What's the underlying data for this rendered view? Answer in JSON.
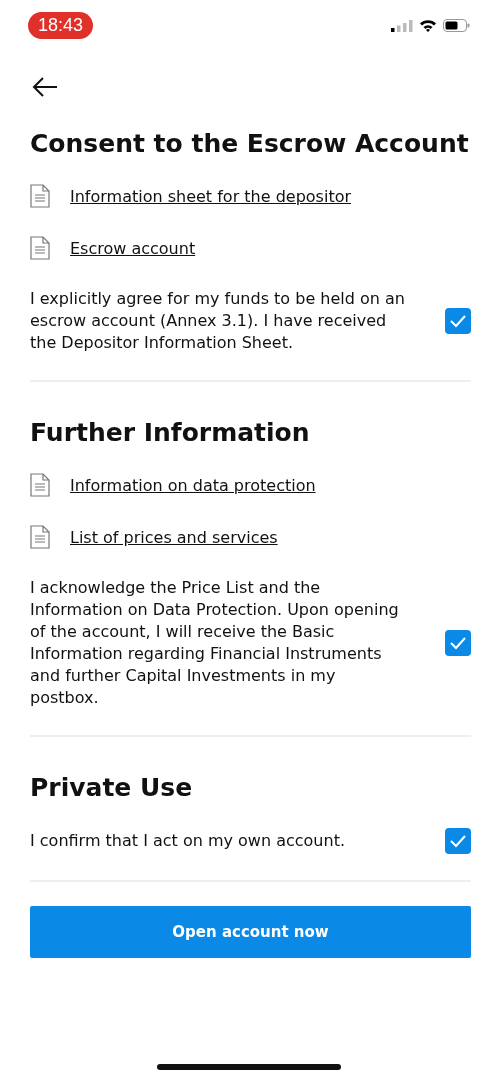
{
  "status_bar": {
    "time": "18:43"
  },
  "sections": [
    {
      "title": "Consent to the Escrow Account",
      "documents": [
        "Information sheet for the depositor",
        "Escrow account"
      ],
      "consent": {
        "text": "I explicitly agree for my funds to be held on an escrow account (Annex 3.1). I have received the Depositor Information Sheet.",
        "checked": true
      }
    },
    {
      "title": "Further Information",
      "documents": [
        "Information on data protection",
        "List of prices and services"
      ],
      "consent": {
        "text": "I acknowledge the Price List and the Information on Data Protection. Upon opening of the account, I will receive the Basic Information regarding Financial Instruments and further Capital Investments in my postbox.",
        "checked": true
      }
    },
    {
      "title": "Private Use",
      "consent": {
        "text": "I confirm that I act on my own account.",
        "checked": true
      }
    }
  ],
  "button": "Open account now"
}
